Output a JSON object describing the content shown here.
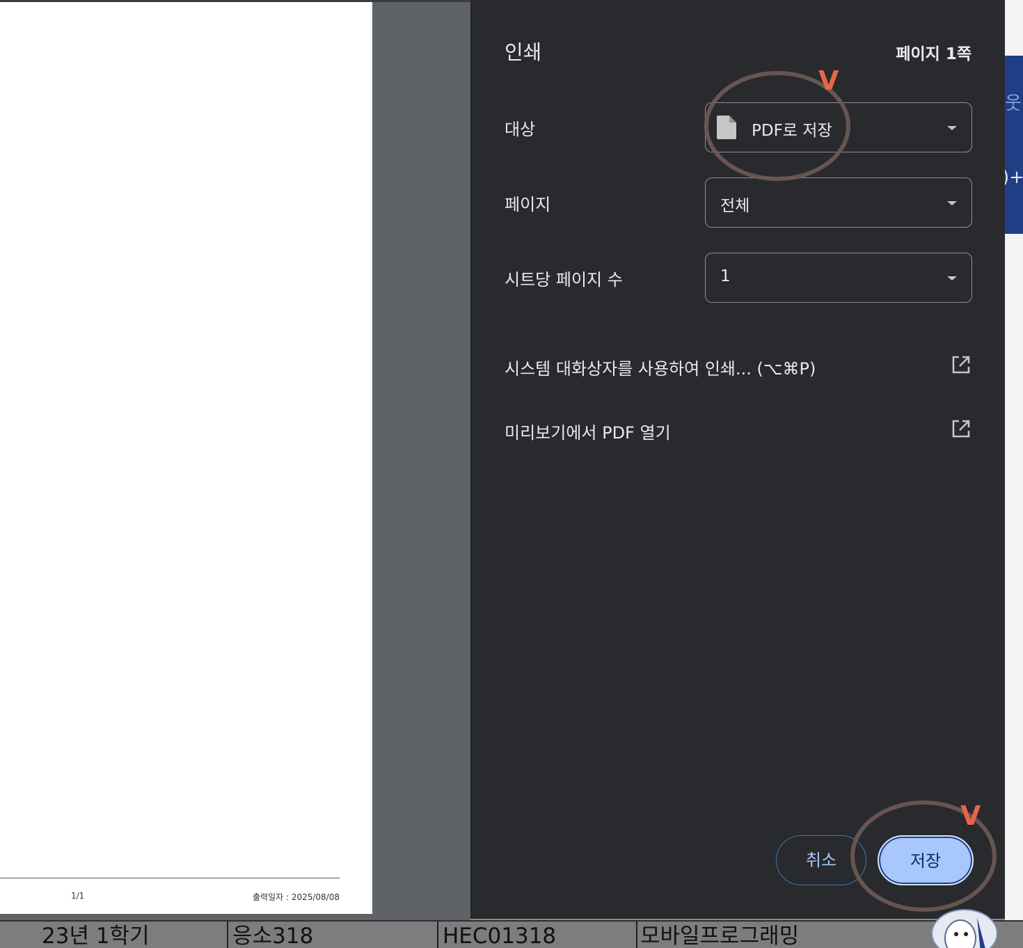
{
  "dialog": {
    "title": "인쇄",
    "page_count": "페이지 1쪽",
    "destination": {
      "label": "대상",
      "value": "PDF로 저장"
    },
    "pages": {
      "label": "페이지",
      "value": "전체"
    },
    "pages_per_sheet": {
      "label": "시트당 페이지 수",
      "value": "1"
    },
    "system_dialog_link": "시스템 대화상자를 사용하여 인쇄... (⌥⌘P)",
    "open_preview_link": "미리보기에서 PDF 열기",
    "cancel_label": "취소",
    "save_label": "저장"
  },
  "preview": {
    "page_number": "1/1",
    "print_date": "출력일자 :  2025/08/08"
  },
  "annotations": {
    "check_mark": "V",
    "check_color": "#e8644a",
    "ring_color": "#6d5a56"
  },
  "background": {
    "glyph_top": "웃",
    "glyph_mid": ")+",
    "row_cells": [
      "23년 1학기",
      "응소318",
      "HEC01318",
      "모바일프로그래밍"
    ]
  },
  "colors": {
    "panel_bg": "#292a2d",
    "accent": "#a8c7fa",
    "preview_bg": "#5f6368"
  }
}
